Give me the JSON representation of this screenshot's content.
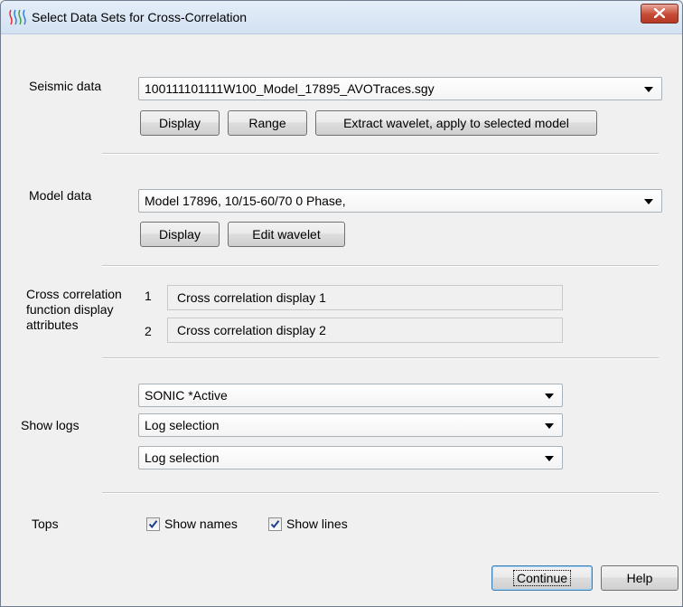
{
  "window": {
    "title": "Select Data Sets for Cross-Correlation"
  },
  "seismic": {
    "label": "Seismic data",
    "selected": "100111101111W100_Model_17895_AVOTraces.sgy",
    "display_label": "Display",
    "range_label": "Range",
    "extract_label": "Extract wavelet, apply to selected model"
  },
  "model": {
    "label": "Model data",
    "selected": "Model 17896, 10/15-60/70   0 Phase,",
    "display_label": "Display",
    "edit_label": "Edit wavelet"
  },
  "cross": {
    "label_line1": "Cross correlation",
    "label_line2": "function display",
    "label_line3": "attributes",
    "rows": [
      {
        "index": "1",
        "value": "Cross correlation display 1"
      },
      {
        "index": "2",
        "value": "Cross correlation display 2"
      }
    ]
  },
  "logs": {
    "label": "Show logs",
    "selections": [
      "SONIC *Active",
      "Log selection",
      "Log selection"
    ]
  },
  "tops": {
    "label": "Tops",
    "show_names_label": "Show names",
    "show_names_checked": true,
    "show_lines_label": "Show lines",
    "show_lines_checked": true
  },
  "footer": {
    "continue_label": "Continue",
    "help_label": "Help"
  },
  "colors": {
    "accent": "#3c7fb1",
    "close": "#c74a36"
  }
}
